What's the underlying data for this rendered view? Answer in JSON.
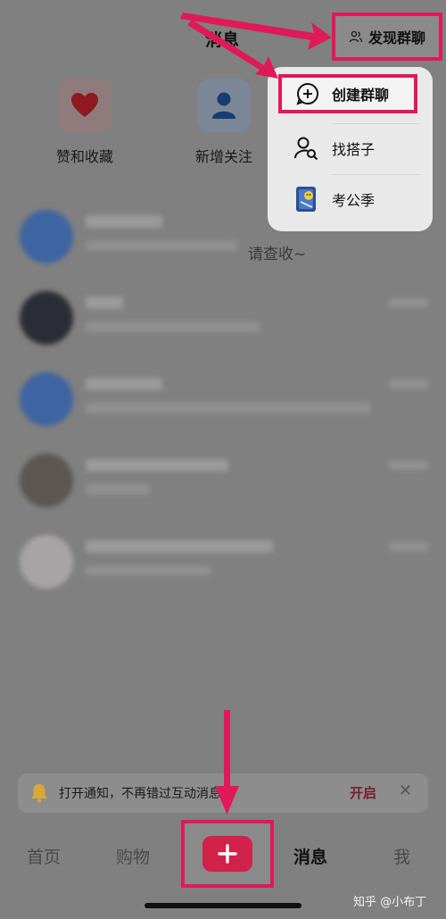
{
  "header": {
    "title": "消息",
    "discover_label": "发现群聊"
  },
  "quick_actions": [
    {
      "label": "赞和收藏",
      "icon": "heart-icon"
    },
    {
      "label": "新增关注",
      "icon": "person-icon"
    }
  ],
  "messages": {
    "preview_tail": "请查收~"
  },
  "menu": {
    "items": [
      {
        "label": "创建群聊",
        "icon": "chat-plus-icon"
      },
      {
        "label": "找搭子",
        "icon": "person-search-icon"
      },
      {
        "label": "考公季",
        "icon": "notebook-icon"
      }
    ]
  },
  "notification": {
    "text": "打开通知，不再错过互动消息",
    "action": "开启",
    "close": "✕"
  },
  "tabbar": {
    "home": "首页",
    "shop": "购物",
    "add": "+",
    "messages": "消息",
    "me": "我"
  },
  "watermark": "知乎 @小布丁",
  "colors": {
    "highlight": "#e0195a",
    "accent_red": "#d0224a"
  }
}
